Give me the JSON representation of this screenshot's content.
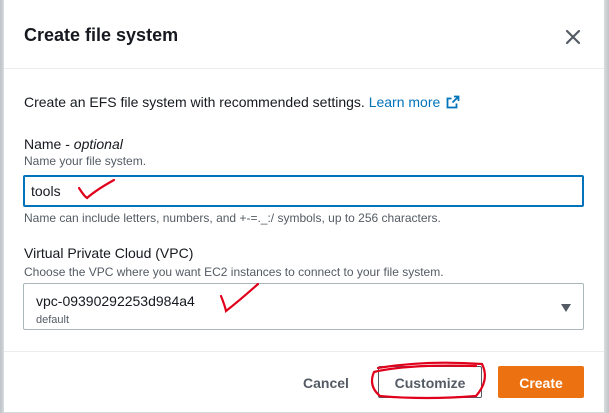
{
  "modal": {
    "title": "Create file system",
    "intro_text": "Create an EFS file system with recommended settings.",
    "learn_more_label": "Learn more"
  },
  "name_field": {
    "label": "Name - ",
    "label_optional": "optional",
    "description": "Name your file system.",
    "value": "tools",
    "constraint": "Name can include letters, numbers, and +-=._:/ symbols, up to 256 characters."
  },
  "vpc_field": {
    "label": "Virtual Private Cloud (VPC)",
    "description": "Choose the VPC where you want EC2 instances to connect to your file system.",
    "selected_value": "vpc-09390292253d984a4",
    "selected_sub": "default"
  },
  "footer": {
    "cancel_label": "Cancel",
    "customize_label": "Customize",
    "create_label": "Create"
  },
  "colors": {
    "link": "#0073bb",
    "primary": "#ec7211",
    "annotation": "#e0001b"
  },
  "icons": {
    "close": "close-icon",
    "external_link": "external-link-icon",
    "dropdown": "caret-down-icon"
  }
}
